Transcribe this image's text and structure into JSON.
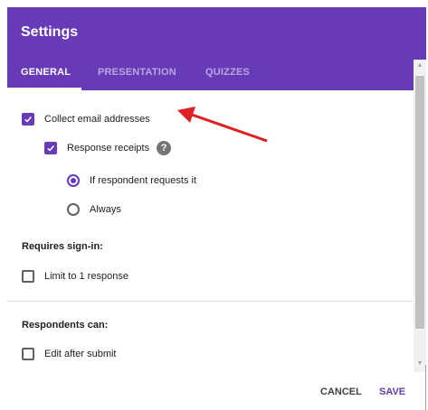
{
  "dialog": {
    "title": "Settings",
    "tabs": [
      {
        "label": "GENERAL",
        "active": true
      },
      {
        "label": "PRESENTATION",
        "active": false
      },
      {
        "label": "QUIZZES",
        "active": false
      }
    ]
  },
  "general": {
    "collect_email": {
      "label": "Collect email addresses",
      "checked": true
    },
    "response_receipts": {
      "label": "Response receipts",
      "checked": true,
      "help_icon": "question-mark"
    },
    "receipt_options": [
      {
        "label": "If respondent requests it",
        "selected": true
      },
      {
        "label": "Always",
        "selected": false
      }
    ],
    "requires_signin": {
      "title": "Requires sign-in:",
      "limit_one": {
        "label": "Limit to 1 response",
        "checked": false
      }
    },
    "respondents_can": {
      "title": "Respondents can:",
      "edit_after_submit": {
        "label": "Edit after submit",
        "checked": false
      }
    }
  },
  "footer": {
    "cancel_label": "CANCEL",
    "save_label": "SAVE"
  },
  "colors": {
    "accent": "#673ab7",
    "annotation_arrow": "#e02020"
  }
}
